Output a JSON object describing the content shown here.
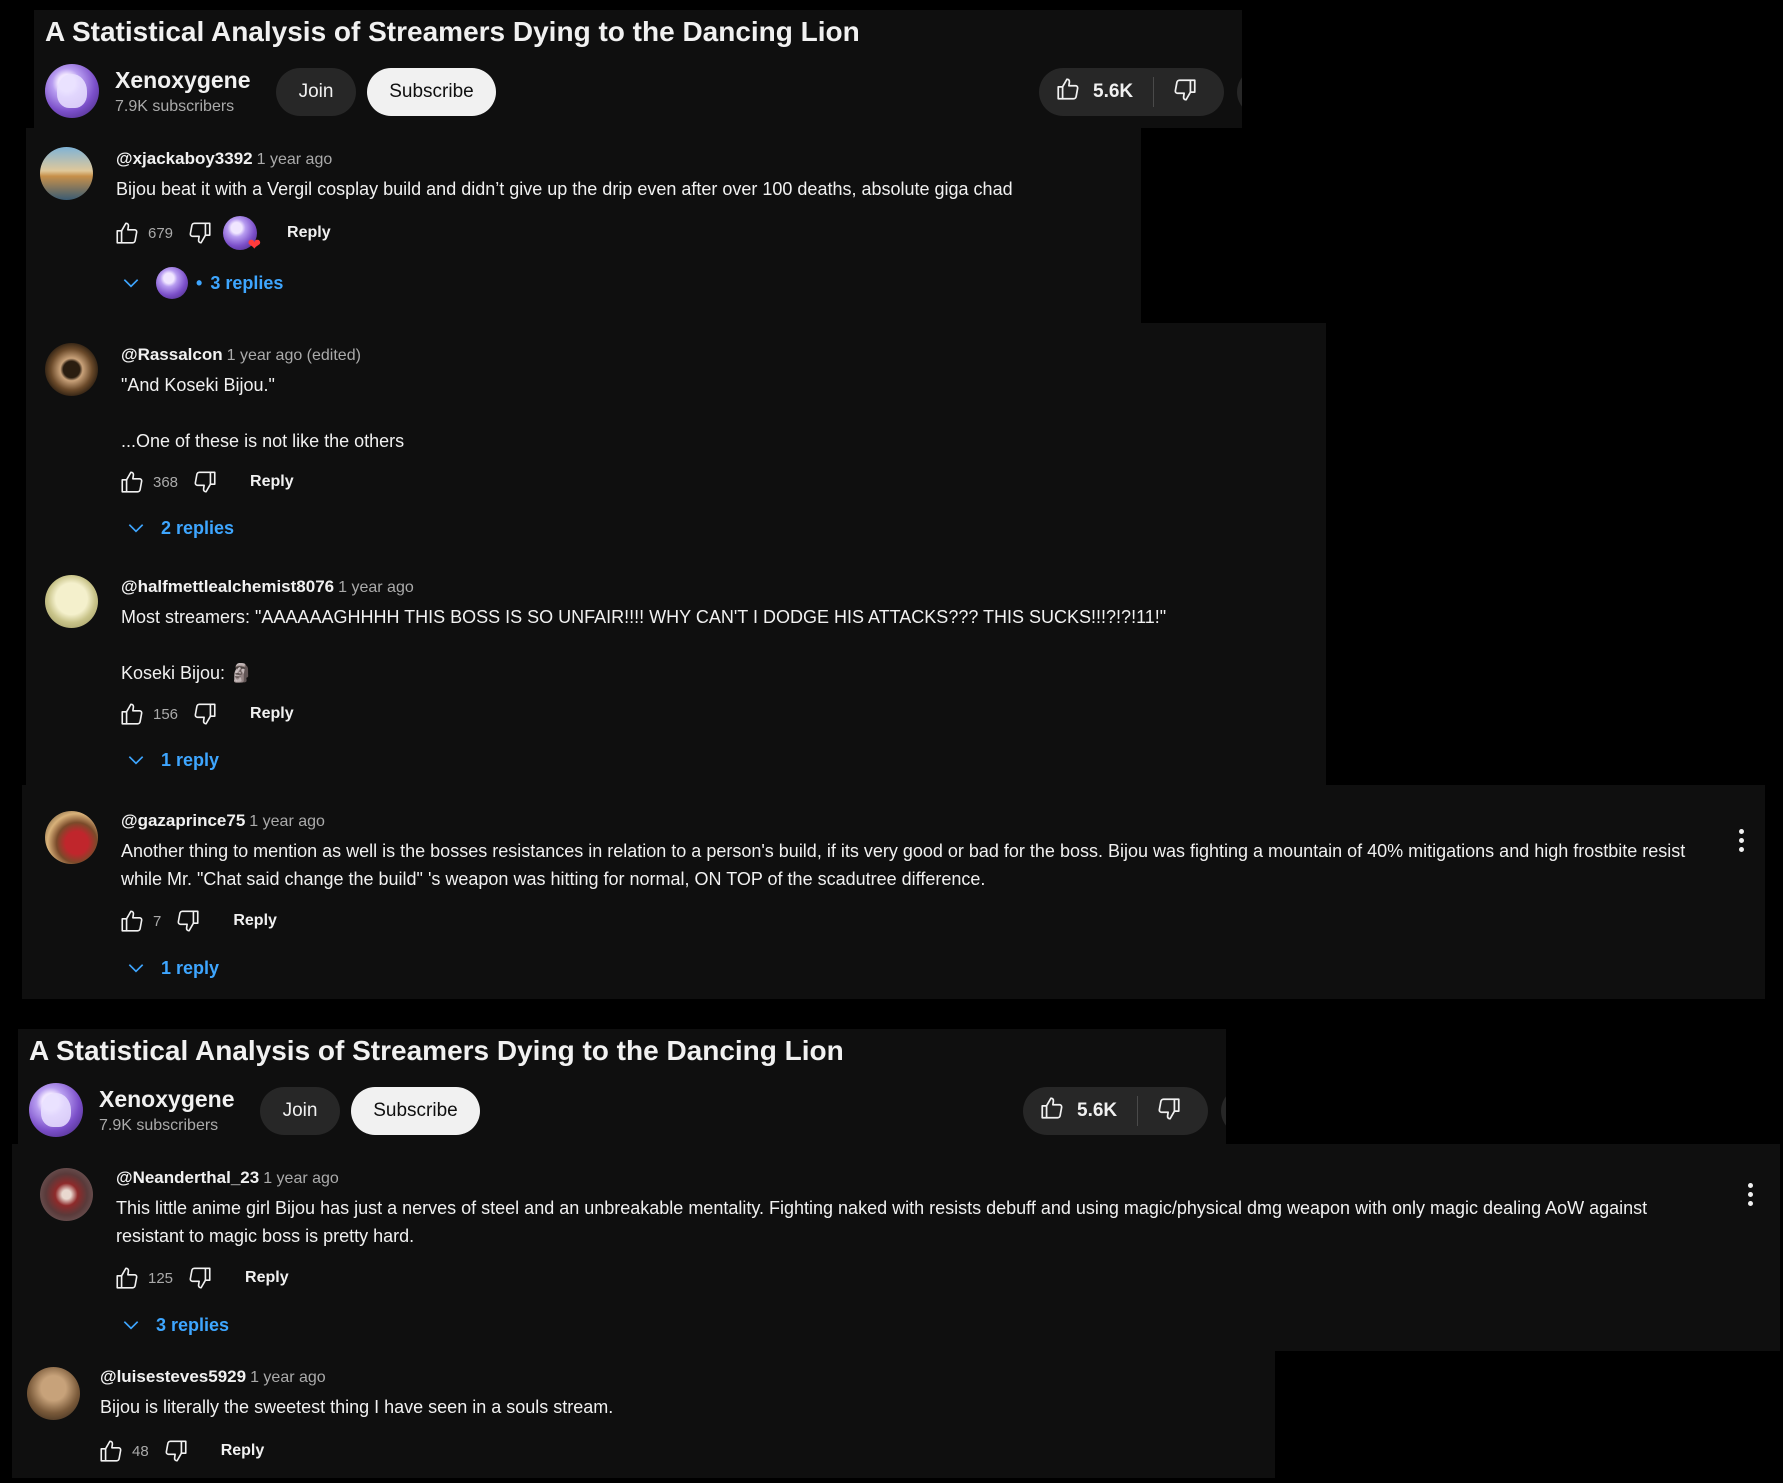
{
  "screens": [
    {
      "video_title": "A Statistical Analysis of Streamers Dying to the Dancing Lion",
      "channel_name": "Xenoxygene",
      "subscribers": "7.9K subscribers",
      "join_label": "Join",
      "subscribe_label": "Subscribe",
      "like_count": "5.6K"
    },
    {
      "video_title": "A Statistical Analysis of Streamers Dying to the Dancing Lion",
      "channel_name": "Xenoxygene",
      "subscribers": "7.9K subscribers",
      "join_label": "Join",
      "subscribe_label": "Subscribe",
      "like_count": "5.6K"
    }
  ],
  "comments": [
    {
      "author": "@xjackaboy3392",
      "time": "1 year ago",
      "text": "Bijou beat it with a Vergil cosplay build and didn’t give up the drip even after over 100 deaths, absolute giga chad",
      "likes": "679",
      "reply_label": "Reply",
      "replies_label": "3 replies",
      "creator_heart": true
    },
    {
      "author": "@Rassalcon",
      "time": "1 year ago (edited)",
      "text": "\"And Koseki Bijou.\"\n\n...One of these is not like the others",
      "likes": "368",
      "reply_label": "Reply",
      "replies_label": "2 replies"
    },
    {
      "author": "@halfmettlealchemist8076",
      "time": "1 year ago",
      "text": "Most streamers: \"AAAAAAGHHHH THIS BOSS IS SO UNFAIR!!!! WHY CAN'T I DODGE HIS ATTACKS??? THIS SUCKS!!!?!?!11!\"\n\nKoseki Bijou: 🗿",
      "likes": "156",
      "reply_label": "Reply",
      "replies_label": "1 reply"
    },
    {
      "author": "@gazaprince75",
      "time": "1 year ago",
      "text": "Another thing to mention as well is the bosses resistances in relation to a person's build, if its very good or bad for the boss. Bijou was fighting a mountain of 40% mitigations and high frostbite resist while Mr. \"Chat said change the build\" 's weapon was hitting for normal, ON TOP of the scadutree difference.",
      "likes": "7",
      "reply_label": "Reply",
      "replies_label": "1 reply"
    },
    {
      "author": "@Neanderthal_23",
      "time": "1 year ago",
      "text": "This little anime girl Bijou has just a nerves of steel and an unbreakable mentality. Fighting naked with resists debuff and using magic/physical dmg weapon with only magic dealing AoW against resistant to magic boss is pretty hard.",
      "likes": "125",
      "reply_label": "Reply",
      "replies_label": "3 replies"
    },
    {
      "author": "@luisesteves5929",
      "time": "1 year ago",
      "text": "Bijou is literally the sweetest thing I have seen in a souls stream.",
      "likes": "48",
      "reply_label": "Reply"
    }
  ]
}
